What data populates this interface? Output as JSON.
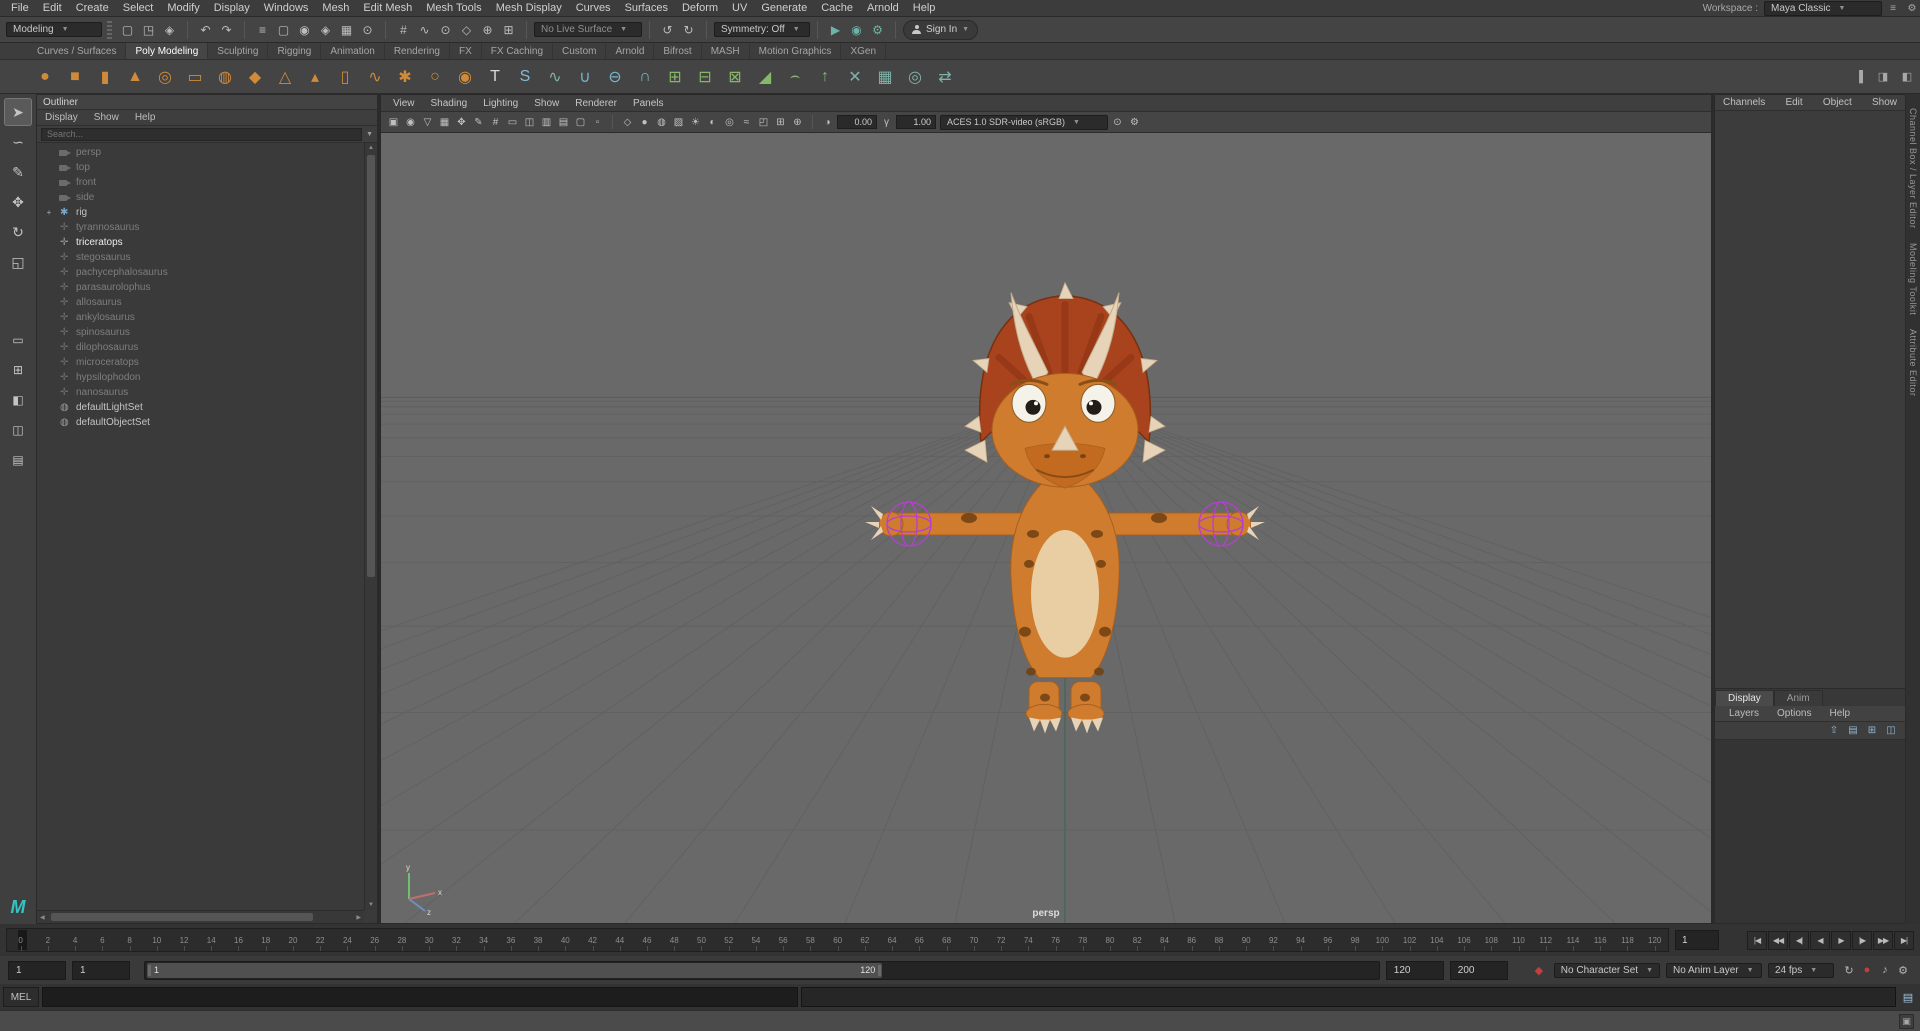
{
  "app": {
    "workspace_label": "Workspace :",
    "workspace_value": "Maya Classic"
  },
  "menubar": {
    "items": [
      "File",
      "Edit",
      "Create",
      "Select",
      "Modify",
      "Display",
      "Windows",
      "Mesh",
      "Edit Mesh",
      "Mesh Tools",
      "Mesh Display",
      "Curves",
      "Surfaces",
      "Deform",
      "UV",
      "Generate",
      "Cache",
      "Arnold",
      "Help"
    ]
  },
  "toolbar": {
    "mode_selector": "Modeling",
    "file_icons": [
      {
        "name": "new-scene-icon",
        "glyph": "▢"
      },
      {
        "name": "open-scene-icon",
        "glyph": "◳"
      },
      {
        "name": "save-scene-icon",
        "glyph": "◈"
      }
    ],
    "undo_icons": [
      {
        "name": "undo-icon",
        "glyph": "↶"
      },
      {
        "name": "redo-icon",
        "glyph": "↷"
      }
    ],
    "mask_icons": [
      {
        "name": "select-hierarchy-icon",
        "glyph": "≡"
      },
      {
        "name": "select-object-icon",
        "glyph": "▢"
      },
      {
        "name": "select-component-icon",
        "glyph": "◉"
      },
      {
        "name": "select-mask-icon",
        "glyph": "◈"
      },
      {
        "name": "highlight-selection-icon",
        "glyph": "▦"
      },
      {
        "name": "rubberband-select-icon",
        "glyph": "⊙"
      }
    ],
    "snap_icons": [
      {
        "name": "snap-to-grid-icon",
        "glyph": "#"
      },
      {
        "name": "snap-to-curve-icon",
        "glyph": "∿"
      },
      {
        "name": "snap-to-point-icon",
        "glyph": "⊙"
      },
      {
        "name": "snap-to-plane-icon",
        "glyph": "◇"
      },
      {
        "name": "snap-to-projected-center-icon",
        "glyph": "⊕"
      },
      {
        "name": "make-live-icon",
        "glyph": "⊞"
      }
    ],
    "live_surface": "No Live Surface",
    "history_icons": [
      {
        "name": "construction-history-icon",
        "glyph": "↺"
      },
      {
        "name": "rebuild-history-icon",
        "glyph": "↻"
      }
    ],
    "symmetry": "Symmetry: Off",
    "render_icons": [
      {
        "name": "render-current-frame-icon",
        "glyph": "▶"
      },
      {
        "name": "ipr-render-icon",
        "glyph": "◉"
      },
      {
        "name": "render-settings-icon",
        "glyph": "⚙"
      }
    ],
    "sign_in": "Sign In"
  },
  "shelf": {
    "tabs": [
      {
        "label": "Curves / Surfaces",
        "cls": ""
      },
      {
        "label": "Poly Modeling",
        "cls": "active"
      },
      {
        "label": "Sculpting",
        "cls": ""
      },
      {
        "label": "Rigging",
        "cls": ""
      },
      {
        "label": "Animation",
        "cls": ""
      },
      {
        "label": "Rendering",
        "cls": ""
      },
      {
        "label": "FX",
        "cls": ""
      },
      {
        "label": "FX Caching",
        "cls": ""
      },
      {
        "label": "Custom",
        "cls": ""
      },
      {
        "label": "Arnold",
        "cls": ""
      },
      {
        "label": "Bifrost",
        "cls": ""
      },
      {
        "label": "MASH",
        "cls": ""
      },
      {
        "label": "Motion Graphics",
        "cls": ""
      },
      {
        "label": "XGen",
        "cls": ""
      }
    ],
    "icons": [
      {
        "name": "poly-sphere-icon",
        "glyph": "●",
        "color": "#cf8a3a"
      },
      {
        "name": "poly-cube-icon",
        "glyph": "■",
        "color": "#cf8a3a"
      },
      {
        "name": "poly-cylinder-icon",
        "glyph": "▮",
        "color": "#cf8a3a"
      },
      {
        "name": "poly-cone-icon",
        "glyph": "▲",
        "color": "#cf8a3a"
      },
      {
        "name": "poly-torus-icon",
        "glyph": "◎",
        "color": "#cf8a3a"
      },
      {
        "name": "poly-plane-icon",
        "glyph": "▭",
        "color": "#cf8a3a"
      },
      {
        "name": "poly-disc-icon",
        "glyph": "◍",
        "color": "#cf8a3a"
      },
      {
        "name": "poly-platonic-icon",
        "glyph": "◆",
        "color": "#cf8a3a"
      },
      {
        "name": "poly-pyramid-icon",
        "glyph": "△",
        "color": "#cf8a3a"
      },
      {
        "name": "poly-prism-icon",
        "glyph": "▴",
        "color": "#cf8a3a"
      },
      {
        "name": "poly-pipe-icon",
        "glyph": "▯",
        "color": "#cf8a3a"
      },
      {
        "name": "poly-helix-icon",
        "glyph": "∿",
        "color": "#cf8a3a"
      },
      {
        "name": "poly-gear-icon",
        "glyph": "✱",
        "color": "#cf8a3a"
      },
      {
        "name": "poly-soccerball-icon",
        "glyph": "○",
        "color": "#cf8a3a"
      },
      {
        "name": "poly-superellipse-icon",
        "glyph": "◉",
        "color": "#cf8a3a"
      },
      {
        "name": "type-tool-icon",
        "glyph": "T",
        "color": "#d8d8d8"
      },
      {
        "name": "svg-tool-icon",
        "glyph": "S",
        "color": "#88b8d8"
      },
      {
        "name": "sweep-mesh-icon",
        "glyph": "∿",
        "color": "#7fb3a9"
      },
      {
        "name": "boolean-union-icon",
        "glyph": "∪",
        "color": "#79b4c9"
      },
      {
        "name": "boolean-difference-icon",
        "glyph": "⊖",
        "color": "#79b4c9"
      },
      {
        "name": "boolean-intersect-icon",
        "glyph": "∩",
        "color": "#79b4c9"
      },
      {
        "name": "combine-icon",
        "glyph": "⊞",
        "color": "#86b86a"
      },
      {
        "name": "separate-icon",
        "glyph": "⊟",
        "color": "#86b86a"
      },
      {
        "name": "extract-icon",
        "glyph": "⊠",
        "color": "#86b86a"
      },
      {
        "name": "bevel-icon",
        "glyph": "◢",
        "color": "#86b86a"
      },
      {
        "name": "bridge-icon",
        "glyph": "⌢",
        "color": "#86b86a"
      },
      {
        "name": "extrude-icon",
        "glyph": "↑",
        "color": "#86b86a"
      },
      {
        "name": "multi-cut-icon",
        "glyph": "✕",
        "color": "#7fb3a9"
      },
      {
        "name": "quad-draw-icon",
        "glyph": "▦",
        "color": "#7fb3a9"
      },
      {
        "name": "target-weld-icon",
        "glyph": "◎",
        "color": "#7fb3a9"
      },
      {
        "name": "mirror-icon",
        "glyph": "⇄",
        "color": "#7fb3a9"
      }
    ],
    "panel_toggles": [
      {
        "name": "channel-box-toggle-icon",
        "glyph": "▐"
      },
      {
        "name": "attribute-editor-toggle-icon",
        "glyph": "◨"
      },
      {
        "name": "tool-settings-toggle-icon",
        "glyph": "◧"
      }
    ]
  },
  "toolbox": {
    "tools": [
      {
        "name": "select-tool",
        "glyph": "➤",
        "cls": "active"
      },
      {
        "name": "lasso-select-tool",
        "glyph": "∽",
        "cls": ""
      },
      {
        "name": "paint-select-tool",
        "glyph": "✎",
        "cls": ""
      },
      {
        "name": "move-tool",
        "glyph": "✥",
        "cls": ""
      },
      {
        "name": "rotate-tool",
        "glyph": "↻",
        "cls": ""
      },
      {
        "name": "scale-tool",
        "glyph": "◱",
        "cls": ""
      }
    ],
    "layouts": [
      {
        "name": "single-pane-layout-button",
        "glyph": "▭"
      },
      {
        "name": "four-pane-layout-button",
        "glyph": "⊞"
      },
      {
        "name": "persp-outliner-layout-button",
        "glyph": "◧"
      },
      {
        "name": "two-pane-layout-button",
        "glyph": "◫"
      },
      {
        "name": "saved-layouts-button",
        "glyph": "▤"
      }
    ]
  },
  "outliner": {
    "title": "Outliner",
    "menus": [
      "Display",
      "Show",
      "Help"
    ],
    "search_placeholder": "Search...",
    "items": [
      {
        "label": "persp",
        "icon": "oi-camera",
        "cls": "dim",
        "tw": ""
      },
      {
        "label": "top",
        "icon": "oi-camera",
        "cls": "dim",
        "tw": ""
      },
      {
        "label": "front",
        "icon": "oi-camera",
        "cls": "dim",
        "tw": ""
      },
      {
        "label": "side",
        "icon": "oi-camera",
        "cls": "dim",
        "tw": ""
      },
      {
        "label": "rig",
        "icon": "oi-rig",
        "cls": "",
        "tw": "+"
      },
      {
        "label": "tyrannosaurus",
        "icon": "oi-mesh",
        "cls": "dim",
        "tw": ""
      },
      {
        "label": "triceratops",
        "icon": "oi-mesh",
        "cls": "sel",
        "tw": ""
      },
      {
        "label": "stegosaurus",
        "icon": "oi-mesh",
        "cls": "dim",
        "tw": ""
      },
      {
        "label": "pachycephalosaurus",
        "icon": "oi-mesh",
        "cls": "dim",
        "tw": ""
      },
      {
        "label": "parasaurolophus",
        "icon": "oi-mesh",
        "cls": "dim",
        "tw": ""
      },
      {
        "label": "allosaurus",
        "icon": "oi-mesh",
        "cls": "dim",
        "tw": ""
      },
      {
        "label": "ankylosaurus",
        "icon": "oi-mesh",
        "cls": "dim",
        "tw": ""
      },
      {
        "label": "spinosaurus",
        "icon": "oi-mesh",
        "cls": "dim",
        "tw": ""
      },
      {
        "label": "dilophosaurus",
        "icon": "oi-mesh",
        "cls": "dim",
        "tw": ""
      },
      {
        "label": "microceratops",
        "icon": "oi-mesh",
        "cls": "dim",
        "tw": ""
      },
      {
        "label": "hypsilophodon",
        "icon": "oi-mesh",
        "cls": "dim",
        "tw": ""
      },
      {
        "label": "nanosaurus",
        "icon": "oi-mesh",
        "cls": "dim",
        "tw": ""
      },
      {
        "label": "defaultLightSet",
        "icon": "oi-set",
        "cls": "",
        "tw": ""
      },
      {
        "label": "defaultObjectSet",
        "icon": "oi-set",
        "cls": "",
        "tw": ""
      }
    ]
  },
  "viewport": {
    "menus": [
      "View",
      "Shading",
      "Lighting",
      "Show",
      "Renderer",
      "Panels"
    ],
    "toolbar": {
      "left_icons": [
        {
          "name": "camera-lock-icon",
          "glyph": "▣"
        },
        {
          "name": "camera-attributes-icon",
          "glyph": "◉"
        },
        {
          "name": "bookmark-icon",
          "glyph": "▽"
        },
        {
          "name": "image-plane-icon",
          "glyph": "▦"
        },
        {
          "name": "2d-pan-zoom-icon",
          "glyph": "✥"
        },
        {
          "name": "grease-pencil-icon",
          "glyph": "✎"
        },
        {
          "name": "grid-toggle-icon",
          "glyph": "#"
        },
        {
          "name": "film-gate-icon",
          "glyph": "▭"
        },
        {
          "name": "resolution-gate-icon",
          "glyph": "◫"
        },
        {
          "name": "gate-mask-icon",
          "glyph": "▥"
        },
        {
          "name": "field-chart-icon",
          "glyph": "▤"
        },
        {
          "name": "safe-action-icon",
          "glyph": "▢"
        },
        {
          "name": "safe-title-icon",
          "glyph": "▫"
        }
      ],
      "shade_icons": [
        {
          "name": "wireframe-icon",
          "glyph": "◇"
        },
        {
          "name": "smooth-shade-icon",
          "glyph": "●"
        },
        {
          "name": "wireframe-on-shaded-icon",
          "glyph": "◍"
        },
        {
          "name": "textured-icon",
          "glyph": "▨"
        },
        {
          "name": "use-lights-icon",
          "glyph": "☀"
        },
        {
          "name": "shadows-icon",
          "glyph": "◐"
        },
        {
          "name": "occlusion-icon",
          "glyph": "◎"
        },
        {
          "name": "motion-blur-icon",
          "glyph": "≈"
        },
        {
          "name": "isolate-select-icon",
          "glyph": "◰"
        },
        {
          "name": "xray-icon",
          "glyph": "⊞"
        },
        {
          "name": "xray-joints-icon",
          "glyph": "⊕"
        }
      ],
      "exposure_label": "0.00",
      "gamma_label": "1.00",
      "view_transform": "ACES 1.0 SDR-video (sRGB)",
      "end_icons": [
        {
          "name": "snapshot-icon",
          "glyph": "⊙"
        },
        {
          "name": "viewport-settings-icon",
          "glyph": "⚙"
        }
      ]
    },
    "camera_label": "persp"
  },
  "right_panel": {
    "menus": [
      "Channels",
      "Edit",
      "Object",
      "Show"
    ],
    "lower": {
      "tabs": [
        {
          "label": "Display",
          "cls": "active"
        },
        {
          "label": "Anim",
          "cls": ""
        }
      ],
      "menus": [
        "Layers",
        "Options",
        "Help"
      ],
      "icons": [
        {
          "name": "move-layer-up-icon",
          "glyph": "⇧"
        },
        {
          "name": "empty-layer-icon",
          "glyph": "▤"
        },
        {
          "name": "layer-from-selected-icon",
          "glyph": "⊞"
        },
        {
          "name": "layer-options-icon",
          "glyph": "◫"
        }
      ]
    }
  },
  "right_strip": {
    "tabs": [
      "Channel Box / Layer Editor",
      "Modeling Toolkit",
      "Attribute Editor"
    ]
  },
  "timeline": {
    "ticks": [
      0,
      2,
      4,
      6,
      8,
      10,
      12,
      14,
      16,
      18,
      20,
      22,
      24,
      26,
      28,
      30,
      32,
      34,
      36,
      38,
      40,
      42,
      44,
      46,
      48,
      50,
      52,
      54,
      56,
      58,
      60,
      62,
      64,
      66,
      68,
      70,
      72,
      74,
      76,
      78,
      80,
      82,
      84,
      86,
      88,
      90,
      92,
      94,
      96,
      98,
      100,
      102,
      104,
      106,
      108,
      110,
      112,
      114,
      116,
      118,
      120
    ],
    "current_frame": "1",
    "playback": [
      {
        "name": "go-to-start-button",
        "glyph": "|◀"
      },
      {
        "name": "step-back-key-button",
        "glyph": "◀◀"
      },
      {
        "name": "step-back-frame-button",
        "glyph": "◀|"
      },
      {
        "name": "play-backwards-button",
        "glyph": "◀"
      },
      {
        "name": "play-forwards-button",
        "glyph": "▶"
      },
      {
        "name": "step-forward-frame-button",
        "glyph": "|▶"
      },
      {
        "name": "step-forward-key-button",
        "glyph": "▶▶"
      },
      {
        "name": "go-to-end-button",
        "glyph": "▶|"
      }
    ]
  },
  "range": {
    "anim_start": "1",
    "play_start": "1",
    "range_start_label": "1",
    "range_end_label": "120",
    "play_end": "120",
    "anim_end": "200",
    "character_set": "No Character Set",
    "anim_layer": "No Anim Layer",
    "fps": "24 fps",
    "icons_right": [
      {
        "name": "playback-loop-icon",
        "glyph": "↻",
        "color": "#b5b5b5"
      },
      {
        "name": "auto-key-icon",
        "glyph": "●",
        "color": "#c04040"
      },
      {
        "name": "mute-sound-icon",
        "glyph": "♪",
        "color": "#b5b5b5"
      },
      {
        "name": "animation-preferences-icon",
        "glyph": "⚙",
        "color": "#b5b5b5"
      }
    ]
  },
  "command_line": {
    "label": "MEL"
  }
}
